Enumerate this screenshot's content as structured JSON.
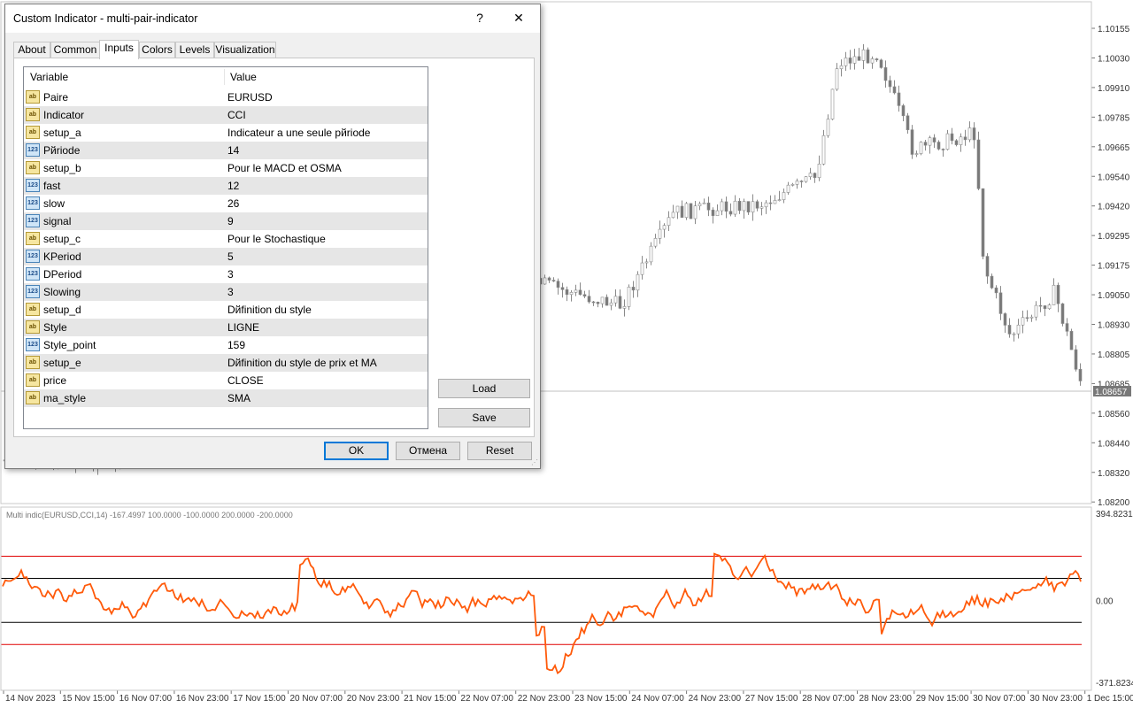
{
  "dialog": {
    "title": "Custom Indicator - multi-pair-indicator",
    "help_label": "?",
    "close_label": "✕",
    "tabs": [
      {
        "label": "About",
        "active": false
      },
      {
        "label": "Common",
        "active": false
      },
      {
        "label": "Inputs",
        "active": true
      },
      {
        "label": "Colors",
        "active": false
      },
      {
        "label": "Levels",
        "active": false
      },
      {
        "label": "Visualization",
        "active": false
      }
    ],
    "table": {
      "col_variable": "Variable",
      "col_value": "Value",
      "rows": [
        {
          "icon": "ab",
          "variable": "Paire",
          "value": "EURUSD"
        },
        {
          "icon": "ab",
          "variable": "Indicator",
          "value": "CCI"
        },
        {
          "icon": "ab",
          "variable": "setup_a",
          "value": " Indicateur a une seule pйriode"
        },
        {
          "icon": "123",
          "variable": "Pйriode",
          "value": "14"
        },
        {
          "icon": "ab",
          "variable": "setup_b",
          "value": "Pour le MACD et OSMA"
        },
        {
          "icon": "123",
          "variable": "fast",
          "value": "12"
        },
        {
          "icon": "123",
          "variable": "slow",
          "value": "26"
        },
        {
          "icon": "123",
          "variable": "signal",
          "value": "9"
        },
        {
          "icon": "ab",
          "variable": "setup_c",
          "value": "Pour le Stochastique"
        },
        {
          "icon": "123",
          "variable": "KPeriod",
          "value": "5"
        },
        {
          "icon": "123",
          "variable": "DPeriod",
          "value": "3"
        },
        {
          "icon": "123",
          "variable": "Slowing",
          "value": "3"
        },
        {
          "icon": "ab",
          "variable": "setup_d",
          "value": "Dйfinition du style"
        },
        {
          "icon": "ab",
          "variable": "Style",
          "value": "LIGNE"
        },
        {
          "icon": "123",
          "variable": "Style_point",
          "value": "159"
        },
        {
          "icon": "ab",
          "variable": "setup_e",
          "value": "Dйfinition du style de prix et MA"
        },
        {
          "icon": "ab",
          "variable": "price",
          "value": "CLOSE"
        },
        {
          "icon": "ab",
          "variable": "ma_style",
          "value": "SMA"
        }
      ]
    },
    "load_label": "Load",
    "save_label": "Save",
    "ok_label": "OK",
    "cancel_label": "Отмена",
    "reset_label": "Reset"
  },
  "chart": {
    "price_labels": [
      "1.10155",
      "1.10030",
      "1.09910",
      "1.09785",
      "1.09665",
      "1.09540",
      "1.09420",
      "1.09295",
      "1.09175",
      "1.09050",
      "1.08930",
      "1.08805",
      "1.08685",
      "1.08560",
      "1.08440",
      "1.08320",
      "1.08200"
    ],
    "current_price": "1.08657",
    "indicator_label": "Multi indic(EURUSD,CCI,14) -167.4997 100.0000 -100.0000 200.0000 -200.0000",
    "indicator_scale": {
      "top": "394.8231",
      "zero": "0.00",
      "bottom": "-371.8234"
    },
    "indicator_levels": [
      200,
      100,
      -100,
      -200
    ],
    "time_labels": [
      "14 Nov 2023",
      "15 Nov 15:00",
      "16 Nov 07:00",
      "16 Nov 23:00",
      "17 Nov 15:00",
      "20 Nov 07:00",
      "20 Nov 23:00",
      "21 Nov 15:00",
      "22 Nov 07:00",
      "22 Nov 23:00",
      "23 Nov 15:00",
      "24 Nov 07:00",
      "24 Nov 23:00",
      "27 Nov 15:00",
      "28 Nov 07:00",
      "28 Nov 23:00",
      "29 Nov 15:00",
      "30 Nov 07:00",
      "30 Nov 23:00",
      "1 Dec 15:00"
    ],
    "colors": {
      "cci_line": "#ff5a0a",
      "level_outer": "#e00000",
      "level_inner": "#000000",
      "bull_candle": "#ffffff",
      "bear_candle": "#787878"
    }
  }
}
